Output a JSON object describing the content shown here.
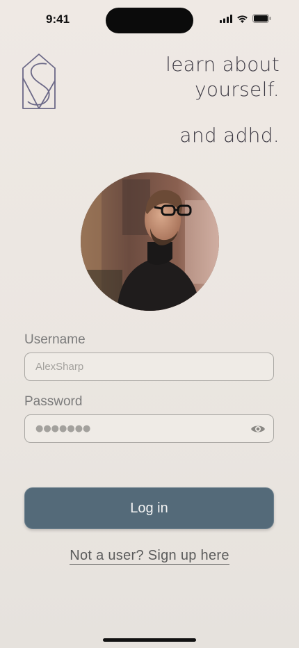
{
  "status_bar": {
    "time": "9:41"
  },
  "header": {
    "tagline_line1": "learn about",
    "tagline_line2": "yourself.",
    "tagline_line3": "and adhd."
  },
  "form": {
    "username_label": "Username",
    "username_value": "AlexSharp",
    "password_label": "Password",
    "password_masked": "●●●●●●●"
  },
  "actions": {
    "login_label": "Log in",
    "signup_link": "Not a user? Sign up here"
  },
  "icons": {
    "logo": "s-house-logo-icon",
    "password_toggle": "eye-icon",
    "signal": "cellular-signal-icon",
    "wifi": "wifi-icon",
    "battery": "battery-icon"
  },
  "colors": {
    "button": "#546a79",
    "logo_stroke": "#6b6887",
    "background": "#ece7e2"
  }
}
